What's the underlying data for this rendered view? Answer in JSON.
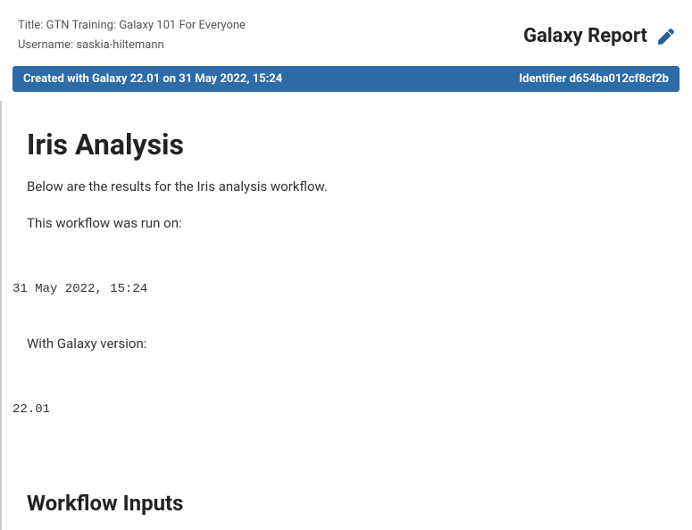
{
  "header": {
    "title_label": "Title:",
    "title_value": "GTN Training: Galaxy 101 For Everyone",
    "username_label": "Username:",
    "username_value": "saskia-hiltemann",
    "report_title": "Galaxy Report"
  },
  "ribbon": {
    "created_text": "Created with Galaxy 22.01 on 31 May 2022, 15:24",
    "identifier_text": "Identifier d654ba012cf8cf2b"
  },
  "body": {
    "heading": "Iris Analysis",
    "intro_para": "Below are the results for the Iris analysis workflow.",
    "run_on_para": "This workflow was run on:",
    "run_on_value": "31 May 2022, 15:24",
    "version_para": "With Galaxy version:",
    "version_value": "22.01",
    "inputs_heading": "Workflow Inputs"
  }
}
